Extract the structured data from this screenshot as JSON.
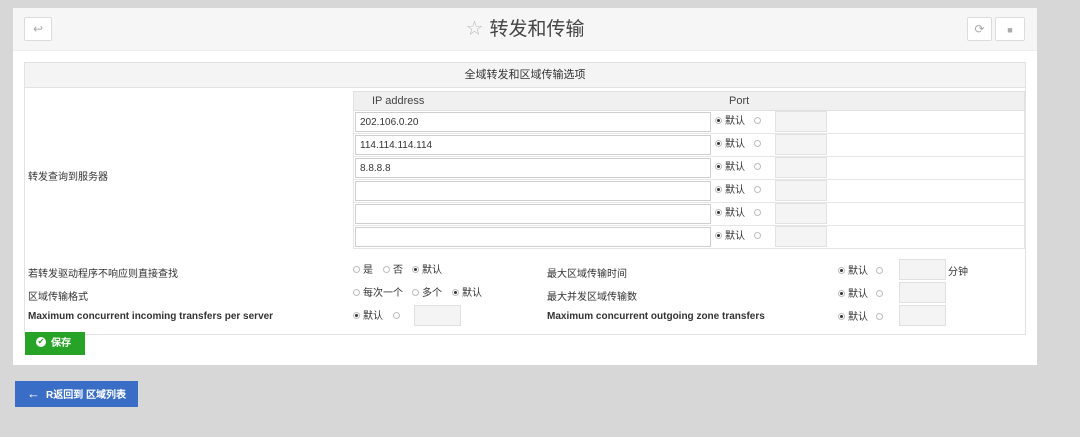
{
  "header": {
    "title": "转发和传输",
    "back_icon": "↩",
    "refresh_icon": "⟳",
    "menu_icon": "■"
  },
  "section": {
    "title": "全域转发和区域传输选项"
  },
  "forwarders": {
    "label": "转发查询到服务器",
    "col_ip": "IP address",
    "col_port": "Port",
    "rows": [
      {
        "ip": "202.106.0.20",
        "default_label": "默认"
      },
      {
        "ip": "114.114.114.114",
        "default_label": "默认"
      },
      {
        "ip": "8.8.8.8",
        "default_label": "默认"
      },
      {
        "ip": "",
        "default_label": "默认"
      },
      {
        "ip": "",
        "default_label": "默认"
      },
      {
        "ip": "",
        "default_label": "默认"
      }
    ]
  },
  "options": {
    "direct_lookup": {
      "label": "若转发驱动程序不响应则直接查找",
      "yes": "是",
      "no": "否",
      "default": "默认"
    },
    "transfer_format": {
      "label": "区域传输格式",
      "each_one": "每次一个",
      "many": "多个",
      "default": "默认"
    },
    "max_incoming": {
      "label": "Maximum concurrent incoming transfers per server",
      "default": "默认"
    },
    "max_transfer_time": {
      "label": "最大区域传输时间",
      "default": "默认",
      "unit": "分钟"
    },
    "max_concurrent": {
      "label": "最大并发区域传输数",
      "default": "默认"
    },
    "max_outgoing": {
      "label": "Maximum concurrent outgoing zone transfers",
      "default": "默认"
    }
  },
  "buttons": {
    "save": "保存",
    "return": "R返回到 区域列表"
  }
}
